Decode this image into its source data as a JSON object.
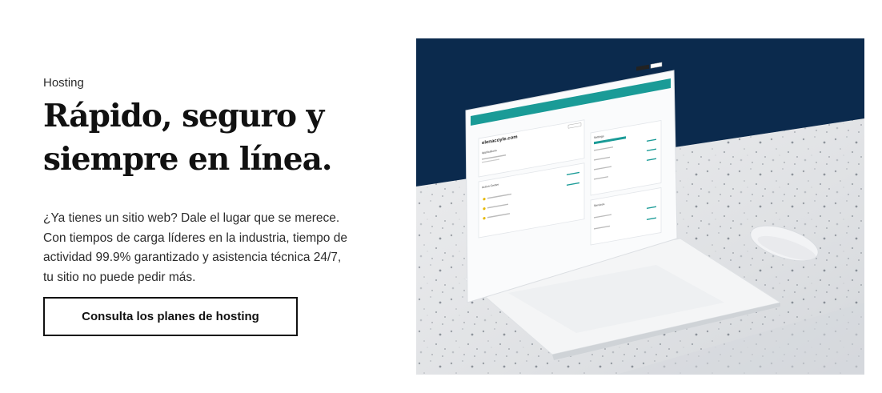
{
  "hero": {
    "eyebrow": "Hosting",
    "headline_line1": "Rápido, seguro y",
    "headline_line2": "siempre en línea.",
    "body": "¿Ya tienes un sitio web? Dale el lugar que se merece. Con tiempos de carga líderes en la industria, tiempo de actividad 99.9% garantizado y asistencia técnica 24/7, tu sitio no puede pedir más.",
    "cta_label": "Consulta los planes de hosting"
  },
  "illustration": {
    "site_name": "elenacoyle.com",
    "panels": {
      "applications": "Applications",
      "action_center": "Action Center",
      "settings": "Settings",
      "services": "Services"
    }
  },
  "colors": {
    "navy_background": "#0b2a4d",
    "teal_bar": "#1a9b97"
  }
}
